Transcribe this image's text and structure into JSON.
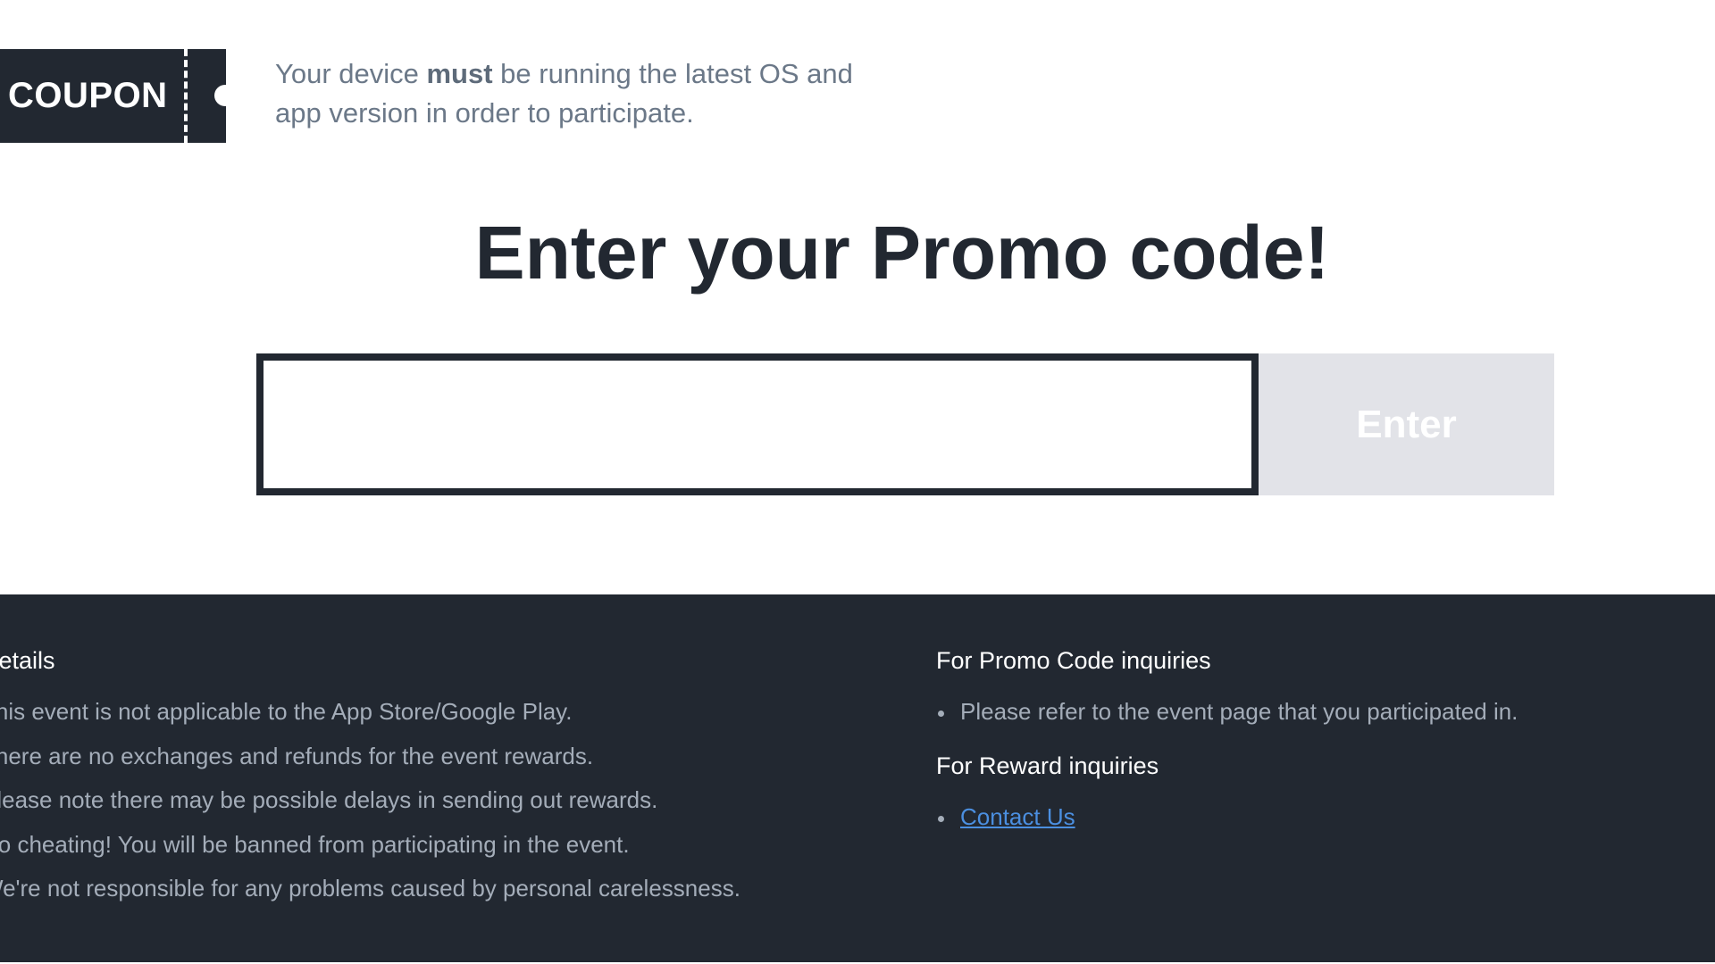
{
  "badge": {
    "label": "COUPON",
    "icon": "coupon-ticket-icon"
  },
  "notice": {
    "prefix": "Your device ",
    "emphasis": "must",
    "suffix": " be running the latest OS and app version in order to participate."
  },
  "heading": "Enter your Promo code!",
  "form": {
    "input_value": "",
    "input_placeholder": "",
    "button_label": "Enter"
  },
  "footer": {
    "details": {
      "title": "Details",
      "items": [
        "This event is not applicable to the App Store/Google Play.",
        "There are no exchanges and refunds for the event rewards.",
        "Please note there may be possible delays in sending out rewards.",
        "No cheating! You will be banned from participating in the event.",
        "We're not responsible for any problems caused by personal carelessness."
      ]
    },
    "promo_inquiries": {
      "title": "For Promo Code inquiries",
      "items": [
        "Please refer to the event page that you participated in."
      ]
    },
    "reward_inquiries": {
      "title": "For Reward inquiries",
      "link_label": "Contact Us"
    }
  },
  "colors": {
    "dark": "#222831",
    "button_disabled": "#e2e3e8",
    "link": "#4b8fe0",
    "muted_text": "#a4adb9"
  }
}
